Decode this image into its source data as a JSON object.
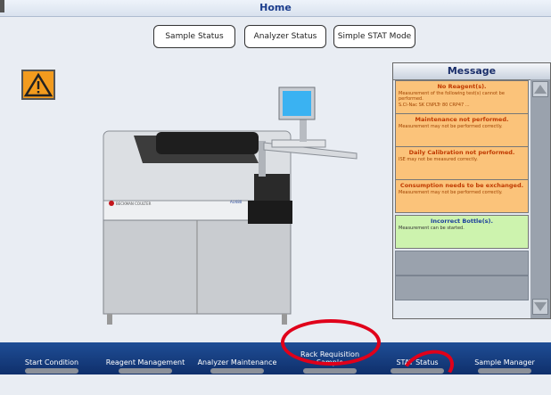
{
  "header": {
    "title": "Home"
  },
  "top_buttons": [
    "Sample Status",
    "Analyzer Status",
    "Simple STAT Mode"
  ],
  "message_panel": {
    "title": "Message",
    "items": [
      {
        "title": "No Reagent(s).",
        "text": "Measurement of the following test(s) cannot be performed.",
        "text2": "S.Cl-Nac SK CNPLTr 80 CRP47 ...",
        "color": "orange"
      },
      {
        "title": "Maintenance not performed.",
        "text": "Measurement may not be performed correctly.",
        "color": "orange"
      },
      {
        "title": "Daily Calibration not performed.",
        "text": "ISE may not be measured correctly.",
        "color": "orange"
      },
      {
        "title": "Consumption needs to be exchanged.",
        "text": "Measurement may not be performed correctly.",
        "color": "orange"
      },
      {
        "title": "Incorrect Bottle(s).",
        "text": "Measurement can be started.",
        "color": "green"
      }
    ]
  },
  "analyzer": {
    "brand": "BECKMAN COULTER",
    "model": "AU480"
  },
  "bottom_nav": [
    {
      "label": "Start Condition"
    },
    {
      "label": "Reagent Management"
    },
    {
      "label": "Analyzer Maintenance"
    },
    {
      "label": "Rack Requisition Sample"
    },
    {
      "label": "STAT Status"
    },
    {
      "label": "Sample Manager"
    }
  ],
  "colors": {
    "accent": "#1f4e96",
    "warning": "#f29b1e",
    "message_orange": "#fbc37a",
    "message_green": "#cdf3ae",
    "annotation_red": "#e0001a"
  },
  "icons": {
    "warning": "warning-triangle-icon",
    "scroll_up": "scroll-up-arrow-icon",
    "scroll_down": "scroll-down-arrow-icon"
  }
}
